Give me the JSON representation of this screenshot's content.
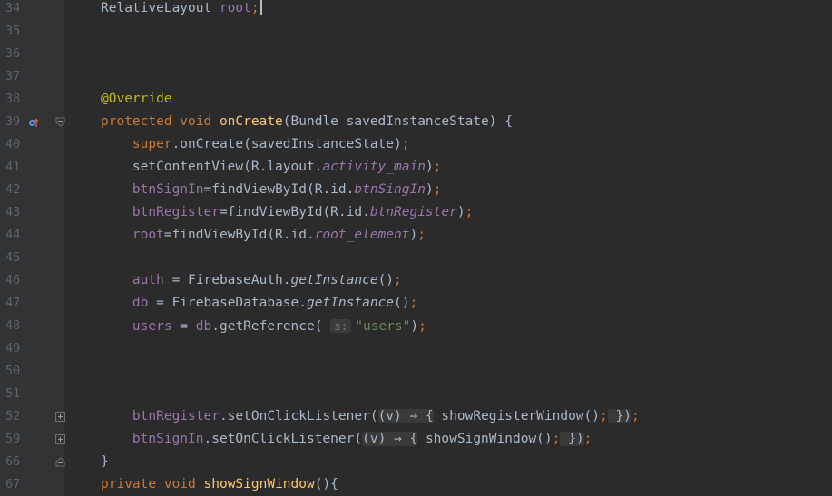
{
  "editor": {
    "lines": [
      {
        "num": "34",
        "code": [
          {
            "t": "RelativeLayout ",
            "c": "plain"
          },
          {
            "t": "root",
            "c": "fld"
          },
          {
            "t": ";",
            "c": "kw"
          }
        ],
        "caret": true
      },
      {
        "num": "35",
        "code": []
      },
      {
        "num": "36",
        "code": []
      },
      {
        "num": "37",
        "code": []
      },
      {
        "num": "38",
        "code": [
          {
            "t": "@Override",
            "c": "ann"
          }
        ]
      },
      {
        "num": "39",
        "code": [
          {
            "t": "protected void ",
            "c": "kw"
          },
          {
            "t": "onCreate",
            "c": "fn"
          },
          {
            "t": "(Bundle savedInstanceState) {",
            "c": "plain"
          }
        ],
        "marker": "override",
        "fold": "open"
      },
      {
        "num": "40",
        "code": [
          {
            "t": "    "
          },
          {
            "t": "super",
            "c": "kw"
          },
          {
            "t": ".onCreate(savedInstanceState)",
            "c": "plain"
          },
          {
            "t": ";",
            "c": "kw"
          }
        ]
      },
      {
        "num": "41",
        "code": [
          {
            "t": "    setContentView(R.layout."
          },
          {
            "t": "activity_main",
            "c": "fld it"
          },
          {
            "t": ")"
          },
          {
            "t": ";",
            "c": "kw"
          }
        ]
      },
      {
        "num": "42",
        "code": [
          {
            "t": "    "
          },
          {
            "t": "btnSignIn",
            "c": "fld"
          },
          {
            "t": "=findViewById(R.id."
          },
          {
            "t": "btnSingIn",
            "c": "fld it"
          },
          {
            "t": ")"
          },
          {
            "t": ";",
            "c": "kw"
          }
        ]
      },
      {
        "num": "43",
        "code": [
          {
            "t": "    "
          },
          {
            "t": "btnRegister",
            "c": "fld"
          },
          {
            "t": "=findViewById(R.id."
          },
          {
            "t": "btnRegister",
            "c": "fld it"
          },
          {
            "t": ")"
          },
          {
            "t": ";",
            "c": "kw"
          }
        ]
      },
      {
        "num": "44",
        "code": [
          {
            "t": "    "
          },
          {
            "t": "root",
            "c": "fld"
          },
          {
            "t": "=findViewById(R.id."
          },
          {
            "t": "root_element",
            "c": "fld it"
          },
          {
            "t": ")"
          },
          {
            "t": ";",
            "c": "kw"
          }
        ]
      },
      {
        "num": "45",
        "code": []
      },
      {
        "num": "46",
        "code": [
          {
            "t": "    "
          },
          {
            "t": "auth",
            "c": "fld"
          },
          {
            "t": " = FirebaseAuth."
          },
          {
            "t": "getInstance",
            "c": "it"
          },
          {
            "t": "()"
          },
          {
            "t": ";",
            "c": "kw"
          }
        ]
      },
      {
        "num": "47",
        "code": [
          {
            "t": "    "
          },
          {
            "t": "db",
            "c": "fld"
          },
          {
            "t": " = FirebaseDatabase."
          },
          {
            "t": "getInstance",
            "c": "it"
          },
          {
            "t": "()"
          },
          {
            "t": ";",
            "c": "kw"
          }
        ]
      },
      {
        "num": "48",
        "code": [
          {
            "t": "    "
          },
          {
            "t": "users",
            "c": "fld"
          },
          {
            "t": " = "
          },
          {
            "t": "db",
            "c": "fld"
          },
          {
            "t": ".getReference( "
          },
          {
            "t": "s:",
            "c": "hint"
          },
          {
            "t": "\"users\"",
            "c": "str"
          },
          {
            "t": ")"
          },
          {
            "t": ";",
            "c": "kw"
          }
        ]
      },
      {
        "num": "49",
        "code": []
      },
      {
        "num": "50",
        "code": []
      },
      {
        "num": "51",
        "code": []
      },
      {
        "num": "52",
        "code": [
          {
            "t": "    "
          },
          {
            "t": "btnRegister",
            "c": "fld"
          },
          {
            "t": ".setOnClickListener("
          },
          {
            "t": "(v) → {",
            "c": "fbox"
          },
          {
            "t": " showRegisterWindow()"
          },
          {
            "t": ";",
            "c": "kw"
          },
          {
            "t": " })",
            "c": "fbox"
          },
          {
            "t": ";",
            "c": "kw"
          }
        ],
        "fold": "closed"
      },
      {
        "num": "59",
        "code": [
          {
            "t": "    "
          },
          {
            "t": "btnSignIn",
            "c": "fld"
          },
          {
            "t": ".setOnClickListener("
          },
          {
            "t": "(v) → {",
            "c": "fbox"
          },
          {
            "t": " showSignWindow()"
          },
          {
            "t": ";",
            "c": "kw"
          },
          {
            "t": " })",
            "c": "fbox"
          },
          {
            "t": ";",
            "c": "kw"
          }
        ],
        "fold": "closed"
      },
      {
        "num": "66",
        "code": [
          {
            "t": "}"
          }
        ],
        "fold": "end"
      },
      {
        "num": "67",
        "code": [
          {
            "t": "private void ",
            "c": "kw"
          },
          {
            "t": "showSignWindow",
            "c": "fn"
          },
          {
            "t": "(){"
          }
        ]
      }
    ]
  },
  "colors": {
    "background": "#2b2b2b",
    "gutter": "#313335",
    "keyword": "#cc7832",
    "annotation": "#bbb529",
    "method_decl": "#ffc66d",
    "field": "#9876aa",
    "string": "#6a8759",
    "plain": "#a9b7c6"
  },
  "icons": {
    "override_marker": "override-method-icon",
    "fold_open": "fold-open-icon",
    "fold_closed": "fold-expand-icon"
  }
}
